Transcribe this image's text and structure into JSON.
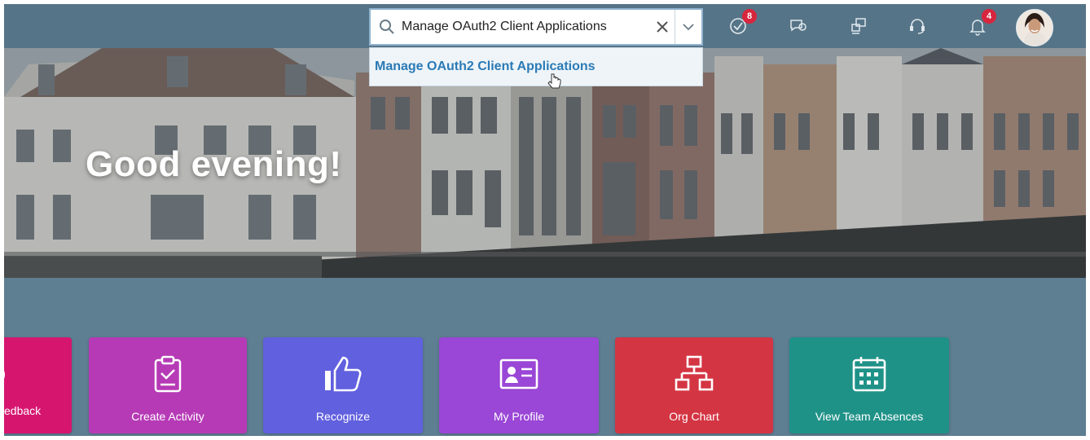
{
  "shellbar": {
    "search": {
      "value": "Manage OAuth2 Client Applications",
      "icon": "search-icon",
      "clear_icon": "close-icon",
      "dropdown_icon": "chevron-down-icon"
    },
    "suggestion": "Manage OAuth2 Client Applications",
    "icons": [
      {
        "name": "todo-icon",
        "badge": "8"
      },
      {
        "name": "chat-icon",
        "badge": ""
      },
      {
        "name": "collaboration-icon",
        "badge": ""
      },
      {
        "name": "support-icon",
        "badge": ""
      },
      {
        "name": "notifications-icon",
        "badge": "4"
      }
    ],
    "colors": {
      "bar": "#567487",
      "badge": "#d7263d",
      "link": "#2a7ab6"
    }
  },
  "hero": {
    "greeting": "Good evening!"
  },
  "tiles": [
    {
      "label": "edback",
      "icon": "feedback-icon",
      "color": "#d6156f"
    },
    {
      "label": "Create Activity",
      "icon": "clipboard-check-icon",
      "color": "#b63ab6"
    },
    {
      "label": "Recognize",
      "icon": "thumbs-up-icon",
      "color": "#6160df"
    },
    {
      "label": "My Profile",
      "icon": "id-card-icon",
      "color": "#9a46d6"
    },
    {
      "label": "Org Chart",
      "icon": "org-chart-icon",
      "color": "#d43543"
    },
    {
      "label": "View Team Absences",
      "icon": "calendar-icon",
      "color": "#1f9288"
    }
  ]
}
